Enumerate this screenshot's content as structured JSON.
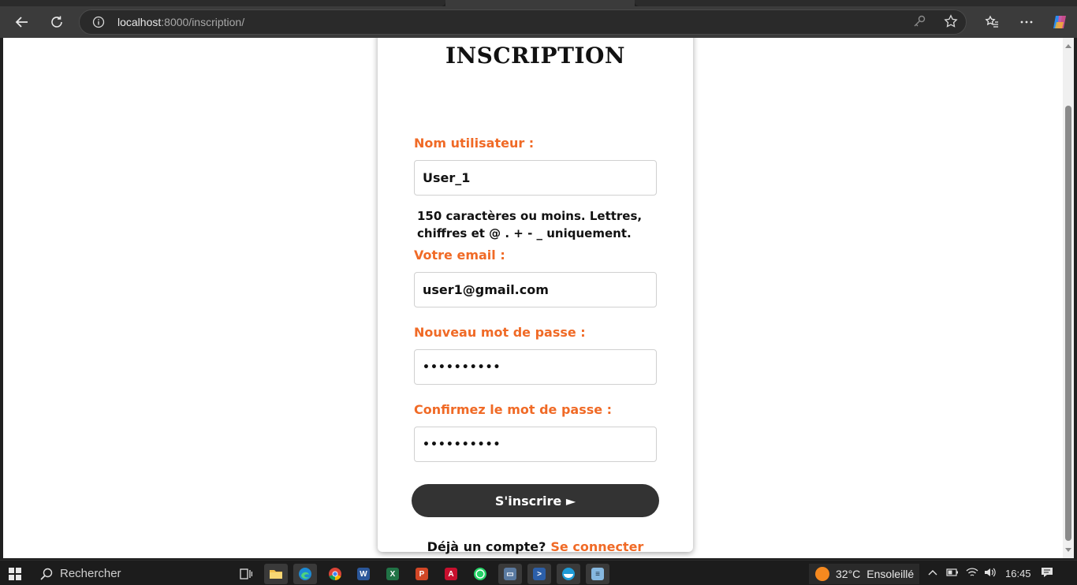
{
  "browser": {
    "url_host": "localhost",
    "url_rest": ":8000/inscription/"
  },
  "form": {
    "title": "INSCRIPTION",
    "username_label": "Nom utilisateur :",
    "username_value": "User_1",
    "username_help": "150 caractères ou moins. Lettres, chiffres et @ . + - _ uniquement.",
    "email_label": "Votre email :",
    "email_value": "user1@gmail.com",
    "password_label": "Nouveau mot de passe :",
    "password_value": "••••••••••",
    "confirm_label": "Confirmez le mot de passe :",
    "confirm_value": "••••••••••",
    "submit_label": "S'inscrire ►",
    "footer_text": "Déjà un compte?",
    "footer_link": "Se connecter"
  },
  "colors": {
    "accent": "#f06a26",
    "button_bg": "#333333"
  },
  "taskbar": {
    "search_label": "Rechercher",
    "weather_temp": "32°C",
    "weather_desc": "Ensoleillé",
    "time": "16:45",
    "apps": [
      "windows-start-icon",
      "search-icon",
      "task-view-icon",
      "file-explorer-icon",
      "edge-icon",
      "chrome-icon",
      "word-icon",
      "excel-icon",
      "powerpoint-icon",
      "acrobat-icon",
      "whatsapp-icon",
      "remote-desktop-icon",
      "powershell-icon",
      "docker-icon",
      "notepad-icon"
    ]
  }
}
